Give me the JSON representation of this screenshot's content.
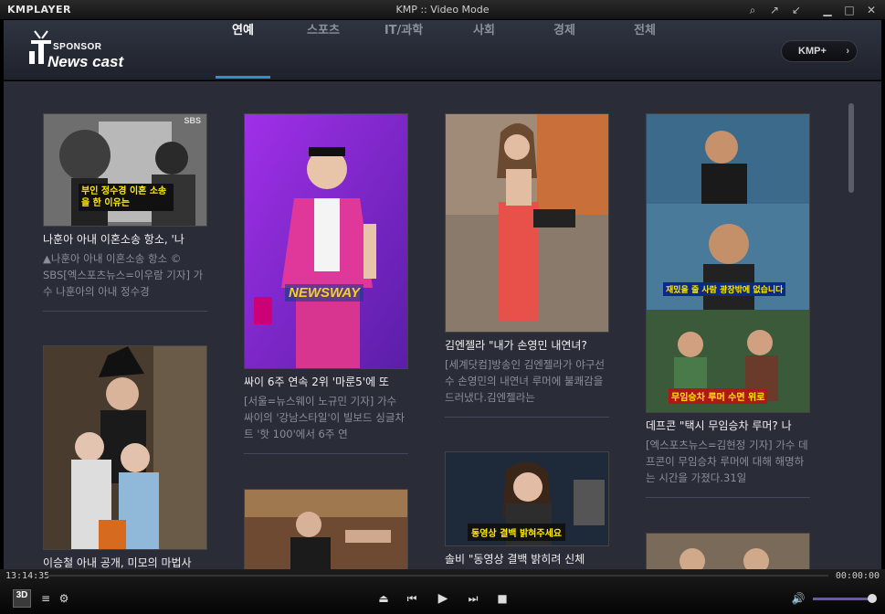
{
  "window": {
    "app_logo": "KMPLAYER",
    "title": "KMP :: Video Mode"
  },
  "brand": {
    "sponsor": "SPONSOR",
    "name": "News cast"
  },
  "tabs": [
    {
      "label": "연예",
      "active": true
    },
    {
      "label": "스포츠",
      "active": false
    },
    {
      "label": "IT/과학",
      "active": false
    },
    {
      "label": "사회",
      "active": false
    },
    {
      "label": "경제",
      "active": false
    },
    {
      "label": "전체",
      "active": false
    }
  ],
  "kmp_plus_label": "KMP+",
  "articles": [
    {
      "title": "나훈아 아내 이혼소송 항소, '나",
      "desc": "▲나훈아 아내 이혼소송 항소 © SBS[엑스포츠뉴스=이우람 기자] 가수 나훈아의 아내 정수경",
      "thumb_caption": "부인 정수경 이혼 소송을 한 이유는",
      "thumb_badge": "SBS"
    },
    {
      "title": "싸이 6주 연속 2위 '마룬5'에 또",
      "desc": "[서울=뉴스웨이 노규민 기자] 가수 싸이의 '강남스타일'이 빌보드 싱글차트 '핫 100'에서 6주 연",
      "thumb_caption": "NEWSWAY"
    },
    {
      "title": "김엔젤라 \"내가 손영민 내연녀?",
      "desc": "[세계닷컴]방송인 김엔젤라가 야구선수 손영민의 내연녀 루머에 불쾌감을 드러냈다.김엔젤라는"
    },
    {
      "title": "데프콘 \"택시 무임승차 루머? 나",
      "desc": "[엑스포츠뉴스=김현정 기자] 가수 데프콘이 무임승차 루머에 대해 해명하는 시간을 가졌다.31일",
      "thumb_caption_1": "재밌을 줄 사람 광장밖에 없습니다",
      "thumb_caption_2": "무임승차 루머 수면 위로"
    },
    {
      "title": "이승철 아내 공개, 미모의 마법사",
      "desc": ""
    },
    {
      "title": "솔비 \"동영상 결백 밝히려 신체",
      "desc": "",
      "thumb_caption": "동영상 결백 밝혀주세요"
    }
  ],
  "player": {
    "time_current": "13:14:35",
    "time_total": "00:00:00"
  },
  "icons": [
    "search-icon",
    "pin-icon",
    "shrink-icon",
    "minimize-icon",
    "maximize-icon",
    "close-icon",
    "playlist-icon",
    "settings-icon",
    "eject-icon",
    "prev-icon",
    "play-icon",
    "next-icon",
    "stop-icon",
    "volume-icon"
  ],
  "colors": {
    "accent": "#2e8fd6",
    "content_bg": "#2a2d38",
    "volume": "#6d5a9a"
  }
}
